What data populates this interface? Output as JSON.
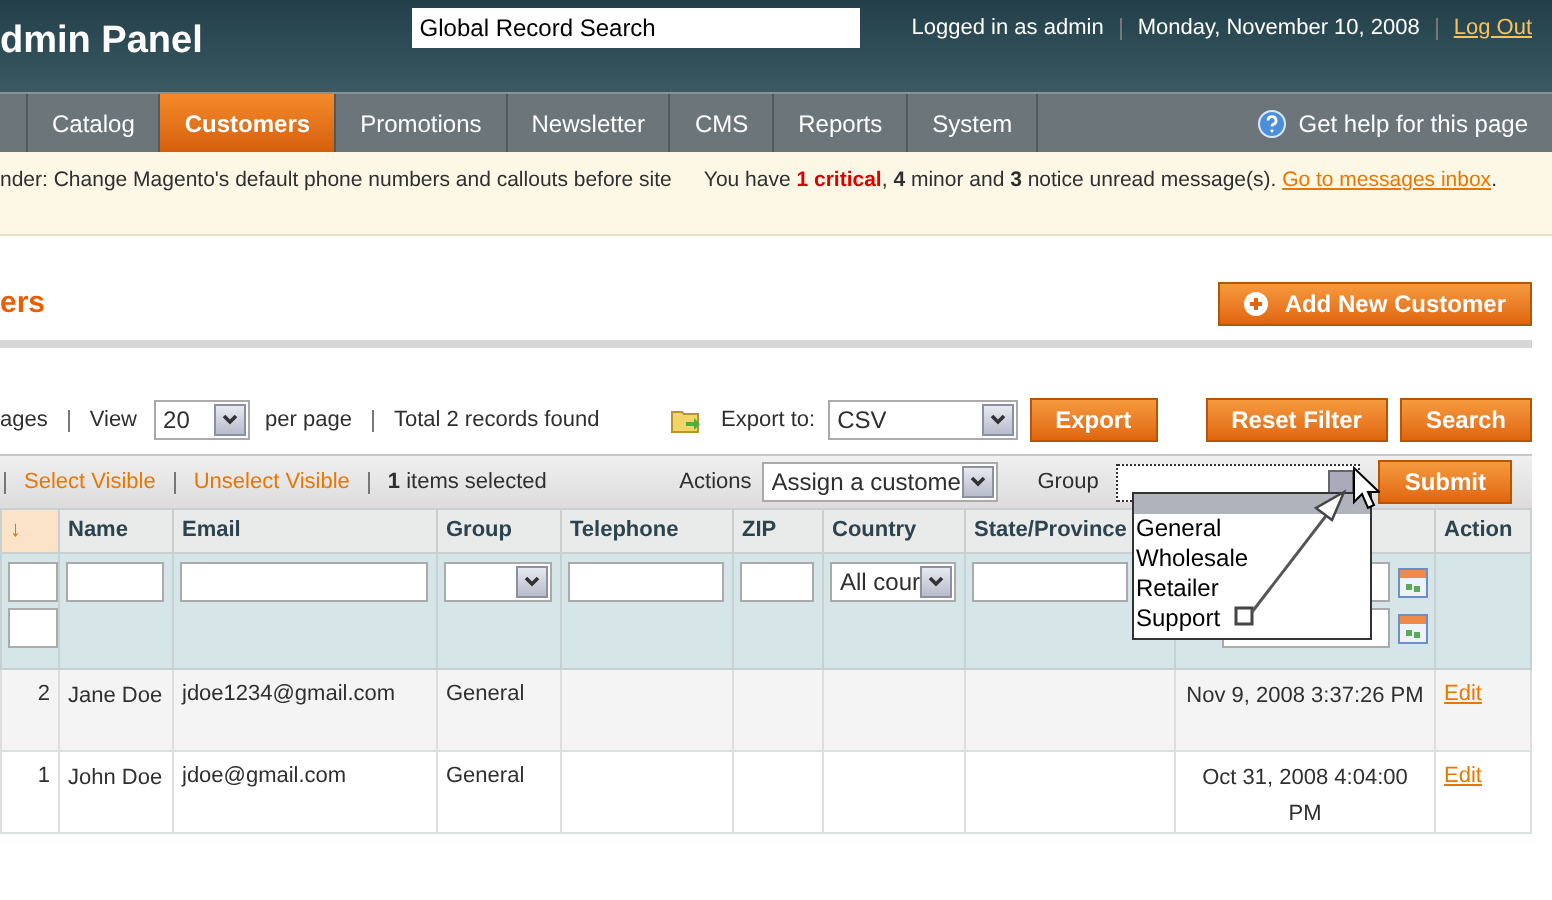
{
  "header": {
    "title": "dmin Panel",
    "search_value": "Global Record Search",
    "user": "Logged in as admin",
    "date": "Monday, November 10, 2008",
    "logout": "Log Out"
  },
  "nav": [
    {
      "label": "Catalog",
      "selected": false
    },
    {
      "label": "Customers",
      "selected": true
    },
    {
      "label": "Promotions",
      "selected": false
    },
    {
      "label": "Newsletter",
      "selected": false
    },
    {
      "label": "CMS",
      "selected": false
    },
    {
      "label": "Reports",
      "selected": false
    },
    {
      "label": "System",
      "selected": false
    }
  ],
  "help": "Get help for this page",
  "notice": {
    "reminder": "nder: Change Magento's default phone numbers and callouts before site",
    "prefix": "You have",
    "critical": "1 critical",
    "rest": ", **4** minor and **3** notice unread message(s).",
    "link": "Go to messages inbox",
    "suffix": "."
  },
  "page_title": "ers",
  "add_button": "Add New Customer",
  "pager": {
    "pages": "ages",
    "view": "View",
    "per_page_value": "20",
    "per_page": "per page",
    "total": "Total 2 records found"
  },
  "export": {
    "label": "Export to:",
    "value": "CSV",
    "button": "Export"
  },
  "filter_buttons": [
    "Reset Filter",
    "Search"
  ],
  "massaction": {
    "select_visible": "Select Visible",
    "unselect_visible": "Unselect Visible",
    "selected": "**1** items selected",
    "actions_label": "Actions",
    "actions_value": "Assign a custome",
    "group_label": "Group",
    "submit": "Submit"
  },
  "group_dropdown": {
    "blank_highlighted": true,
    "options": [
      {
        "label": "General",
        "selected": false
      },
      {
        "label": "Wholesale",
        "selected": false
      },
      {
        "label": "Retailer",
        "selected": false
      },
      {
        "label": "Support",
        "selected": false
      }
    ]
  },
  "table": {
    "columns": [
      {
        "label": "↓",
        "sorted": true,
        "kind": "range"
      },
      {
        "label": "Name",
        "sorted": false,
        "kind": "text"
      },
      {
        "label": "Email",
        "sorted": false,
        "kind": "text"
      },
      {
        "label": "Group",
        "sorted": false,
        "kind": "select"
      },
      {
        "label": "Telephone",
        "sorted": false,
        "kind": "text"
      },
      {
        "label": "ZIP",
        "sorted": false,
        "kind": "text"
      },
      {
        "label": "Country",
        "sorted": false,
        "kind": "select",
        "filter_value": "All cour"
      },
      {
        "label": "State/Province",
        "sorted": false,
        "kind": "text"
      },
      {
        "sorted": false,
        "kind": "date_range"
      },
      {
        "label": "Action",
        "sorted": false,
        "kind": "none"
      }
    ],
    "rows": [
      {
        "id": "2",
        "name": "Jane Doe",
        "email": "jdoe1234@gmail.com",
        "group": "General",
        "since": "Nov 9, 2008 3:37:26 PM",
        "action": "Edit"
      },
      {
        "id": "1",
        "name": "John Doe",
        "email": "jdoe@gmail.com",
        "group": "General",
        "since": "Oct 31, 2008 4:04:00 PM",
        "action": "Edit"
      }
    ]
  }
}
